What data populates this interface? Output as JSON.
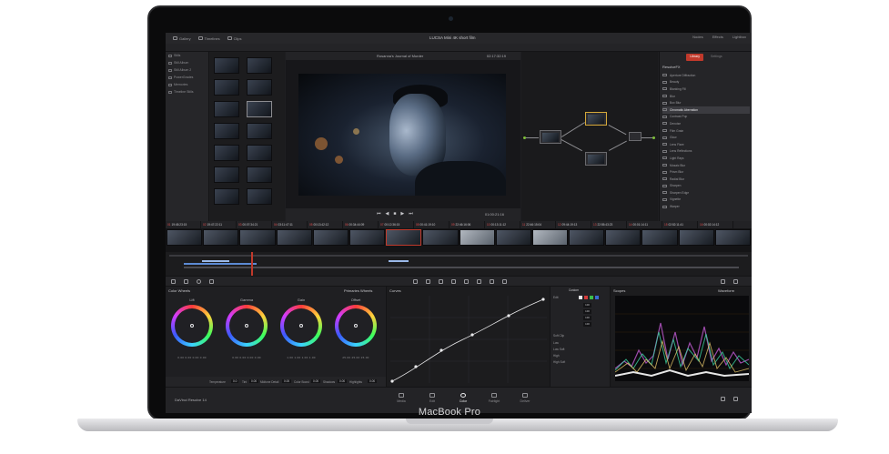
{
  "device": {
    "brand_label": "MacBook Pro"
  },
  "topbar": {
    "tabs": [
      "Gallery",
      "Timelines",
      "Clips"
    ],
    "project_title": "LUCSA Mini 4K short film",
    "right_items": [
      "Nodes",
      "Effects",
      "Lightbox"
    ]
  },
  "album_panel": {
    "items": [
      "Stills",
      "Still Album",
      "Still Album 2",
      "PowerGrades",
      "Memories",
      "Timeline Stills"
    ]
  },
  "viewer": {
    "clip_name": "Rosanna's Journal of Murder",
    "timecode_top": "02:17:32:19",
    "timecode_bottom": "01:00:21:16"
  },
  "effects_panel": {
    "tabs": [
      "Library",
      "Settings"
    ],
    "section": "ResolveFX",
    "items": [
      "Aperture Diffraction",
      "Beauty",
      "Blanking Fill",
      "Blur",
      "Box Blur",
      "Chromatic Aberration",
      "Contrast Pop",
      "Denoise",
      "Film Grain",
      "Glow",
      "Lens Flare",
      "Lens Reflections",
      "Light Rays",
      "Mosaic Blur",
      "Prism Blur",
      "Radial Blur",
      "Sharpen",
      "Sharpen Edge",
      "Vignette",
      "Warper"
    ],
    "selected_index": 5
  },
  "clipbar": {
    "items": [
      {
        "n": "01",
        "tc": "19:45:23:15"
      },
      {
        "n": "02",
        "tc": "19:47:22:11"
      },
      {
        "n": "03",
        "tc": "00:07:34:21"
      },
      {
        "n": "04",
        "tc": "03:11:47:11"
      },
      {
        "n": "05",
        "tc": "00:13:42:12"
      },
      {
        "n": "06",
        "tc": "00:34:44:09"
      },
      {
        "n": "07",
        "tc": "00:12:36:15"
      },
      {
        "n": "08",
        "tc": "00:41:19:10"
      },
      {
        "n": "09",
        "tc": "22:46:16:06"
      },
      {
        "n": "10",
        "tc": "00:13:11:12"
      },
      {
        "n": "11",
        "tc": "22:46:15:04"
      },
      {
        "n": "12",
        "tc": "09:44:19:13"
      },
      {
        "n": "13",
        "tc": "22:55:43:23"
      },
      {
        "n": "14",
        "tc": "00:01:14:11"
      },
      {
        "n": "15",
        "tc": "02:52:11:41"
      },
      {
        "n": "16",
        "tc": "00:02:14:12"
      }
    ]
  },
  "wheels": {
    "title": "Color Wheels",
    "mode": "Primaries Wheels",
    "items": [
      {
        "label": "Lift",
        "vals": "0.00  0.00  0.00  0.00"
      },
      {
        "label": "Gamma",
        "vals": "0.00  0.00  0.00  0.00"
      },
      {
        "label": "Gain",
        "vals": "1.00  1.00  1.00  1.00"
      },
      {
        "label": "Offset",
        "vals": "25.00  25.00  25.00"
      }
    ],
    "adjust": [
      {
        "label": "Temperature",
        "val": "0.0"
      },
      {
        "label": "Tint",
        "val": "0.00"
      },
      {
        "label": "Midtone Detail",
        "val": "0.00"
      },
      {
        "label": "Color Boost",
        "val": "0.00"
      },
      {
        "label": "Shadows",
        "val": "0.00"
      },
      {
        "label": "Highlights",
        "val": "0.00"
      }
    ]
  },
  "curves": {
    "title": "Curves"
  },
  "custom": {
    "title": "Custom",
    "edit_label": "Edit",
    "softclip_label": "Soft Clip",
    "vals": [
      "100",
      "100",
      "100",
      "100"
    ],
    "rows": [
      "Low",
      "Low Soft",
      "High",
      "High Soft"
    ]
  },
  "scopes": {
    "title": "Scopes",
    "mode": "Waveform"
  },
  "pages": [
    "Media",
    "Edit",
    "Color",
    "Fairlight",
    "Deliver"
  ],
  "active_page": "Color",
  "app_name": "DaVinci Resolve 14",
  "colors": {
    "accent": "#c0392b",
    "panel": "#1f1f22",
    "ui_text": "#c8c8cc"
  }
}
